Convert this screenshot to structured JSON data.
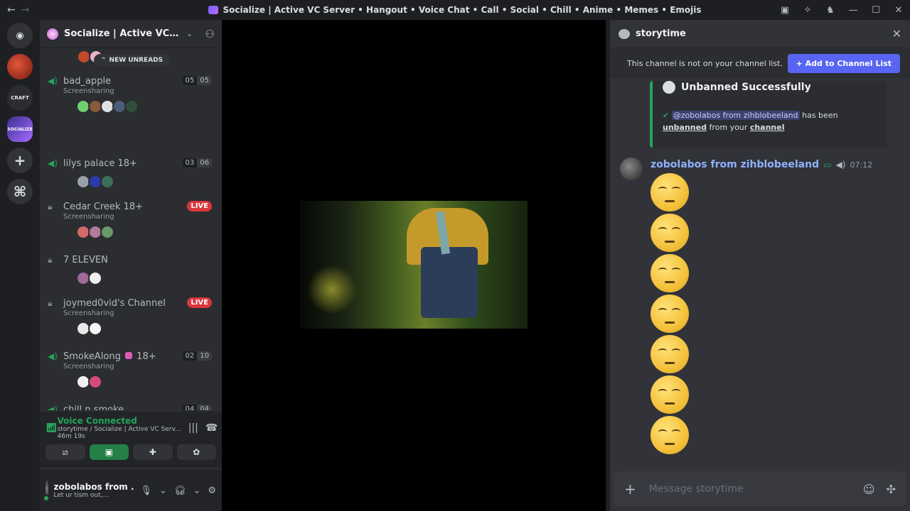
{
  "titlebar": {
    "back": "←",
    "forward": "→",
    "title": "Socialize | Active VC Server • Hangout • Voice Chat • Call • Social • Chill • Anime • Memes • Emojis",
    "icons": [
      "inbox-icon",
      "tools-icon",
      "activity-icon"
    ],
    "window": [
      "—",
      "☐",
      "✕"
    ]
  },
  "servers": {
    "home_label": "◉",
    "s2_label": "CRAFT",
    "s3_label": "SOCIALIZE",
    "add": "+",
    "explore": "⌘"
  },
  "server": {
    "name": "Socialize | Active VC Server"
  },
  "channel_list": {
    "new_unreads": "NEW UNREADS",
    "channels": [
      {
        "name": "bad_apple",
        "sub": "Screensharing",
        "count_a": "05",
        "count_b": "05"
      },
      {
        "name": "lilys palace 18+",
        "sub": "",
        "count_a": "03",
        "count_b": "06"
      },
      {
        "name": "Cedar Creek 18+",
        "sub": "Screensharing",
        "live": "LIVE"
      },
      {
        "name": "7 ELEVEN",
        "sub": ""
      },
      {
        "name": "joymed0vid's Channel",
        "sub": "Screensharing",
        "live": "LIVE"
      },
      {
        "name_a": "SmokeAlong",
        "name_b": "18+",
        "sub": "Screensharing",
        "count_a": "02",
        "count_b": "10"
      },
      {
        "name": "chill n smoke",
        "sub": "",
        "count_a": "04",
        "count_b": "04"
      }
    ]
  },
  "voice": {
    "title": "Voice Connected",
    "location": "storytime / Socialize | Active VC Serv...",
    "elapsed": "46m 19s"
  },
  "user": {
    "name": "zobolabos from ...",
    "status": "Let ur tism out,..."
  },
  "chat": {
    "channel": "storytime",
    "notice": "This channel is not on your channel list.",
    "add_button": "Add to Channel List",
    "embed": {
      "title": "Unbanned Successfully",
      "mention": "@zobolabos from zihblobeeland",
      "text_a": "has been",
      "bold_a": "unbanned",
      "text_b": "from your",
      "bold_b": "channel"
    },
    "message": {
      "author": "zobolabos from zihblobeeland",
      "time": "07:12",
      "emoji_count": 7
    },
    "composer_placeholder": "Message storytime"
  }
}
